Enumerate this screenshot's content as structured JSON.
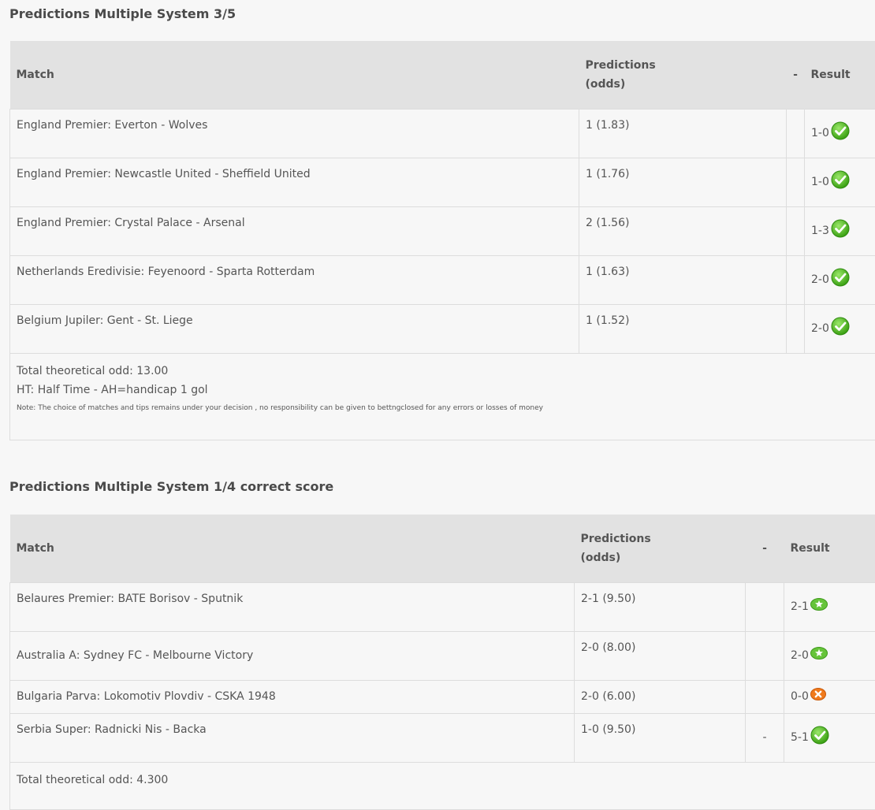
{
  "section1": {
    "title": "Predictions Multiple System 3/5",
    "headers": {
      "match": "Match",
      "pred_line1": "Predictions",
      "pred_line2": "(odds)",
      "dash": "-",
      "result": "Result"
    },
    "rows": [
      {
        "match": "England Premier: Everton - Wolves",
        "prediction": "1 (1.83)",
        "dash": "",
        "result": "1-0",
        "status": "check-icon"
      },
      {
        "match": "England Premier: Newcastle United - Sheffield United",
        "prediction": "1 (1.76)",
        "dash": "",
        "result": "1-0",
        "status": "check-icon"
      },
      {
        "match": "England Premier: Crystal Palace - Arsenal",
        "prediction": "2 (1.56)",
        "dash": "",
        "result": "1-3",
        "status": "check-icon"
      },
      {
        "match": "Netherlands Eredivisie: Feyenoord - Sparta Rotterdam",
        "prediction": "1 (1.63)",
        "dash": "",
        "result": "2-0",
        "status": "check-icon"
      },
      {
        "match": "Belgium Jupiler: Gent - St. Liege",
        "prediction": "1 (1.52)",
        "dash": "",
        "result": "2-0",
        "status": "check-icon"
      }
    ],
    "total": "Total theoretical odd: 13.00",
    "legend": "HT: Half Time - AH=handicap 1 gol",
    "note": "Note: The choice of matches and tips remains under your decision , no responsibility can be given to bettngclosed for any errors or losses of money"
  },
  "section2": {
    "title": "Predictions Multiple System 1/4 correct score",
    "headers": {
      "match": "Match",
      "pred_line1": "Predictions",
      "pred_line2": "(odds)",
      "dash": "-",
      "result": "Result"
    },
    "rows": [
      {
        "match": "Belaures Premier: BATE Borisov - Sputnik",
        "prediction": "2-1 (9.50)",
        "dash": "",
        "result": "2-1",
        "status": "star-icon"
      },
      {
        "match": "Australia A: Sydney FC - Melbourne Victory",
        "prediction": "2-0 (8.00)",
        "dash": "",
        "result": "2-0",
        "status": "star-icon"
      },
      {
        "match": "Bulgaria Parva: Lokomotiv Plovdiv - CSKA 1948",
        "prediction": "2-0 (6.00)",
        "dash": "",
        "result": "0-0",
        "status": "cross-icon"
      },
      {
        "match": "Serbia Super: Radnicki Nis - Backa",
        "prediction": "1-0 (9.50)",
        "dash": "-",
        "result": "5-1",
        "status": "check-icon"
      }
    ],
    "total": "Total theoretical odd: 4.300"
  },
  "colors": {
    "header_bg": "#e2e2e2",
    "page_bg": "#f7f7f7",
    "check_green": "#5cc22a",
    "cross_orange": "#f07a1c"
  }
}
